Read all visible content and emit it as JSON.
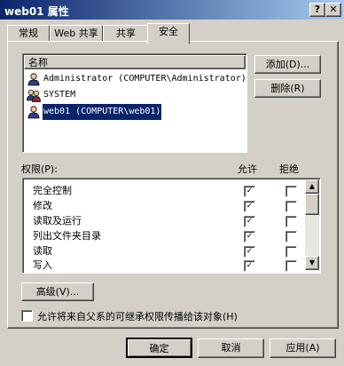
{
  "window": {
    "title": "web01 属性",
    "help_btn": "?",
    "close_btn": "✕"
  },
  "tabs": [
    {
      "label": "常规"
    },
    {
      "label": "Web 共享"
    },
    {
      "label": "共享"
    },
    {
      "label": "安全"
    }
  ],
  "users": {
    "header": "名称",
    "items": [
      {
        "name": "Administrator (COMPUTER\\Administrator)",
        "icon": "user-icon"
      },
      {
        "name": "SYSTEM",
        "icon": "group-icon"
      },
      {
        "name": "web01 (COMPUTER\\web01)",
        "icon": "user-icon",
        "selected": true
      }
    ],
    "add_button": "添加(D)...",
    "remove_button": "删除(R)"
  },
  "permissions": {
    "label": "权限(P):",
    "allow_header": "允许",
    "deny_header": "拒绝",
    "items": [
      {
        "name": "完全控制",
        "allow": true,
        "deny": false
      },
      {
        "name": "修改",
        "allow": true,
        "deny": false
      },
      {
        "name": "读取及运行",
        "allow": true,
        "deny": false
      },
      {
        "name": "列出文件夹目录",
        "allow": true,
        "deny": false
      },
      {
        "name": "读取",
        "allow": true,
        "deny": false
      },
      {
        "name": "写入",
        "allow": true,
        "deny": false
      }
    ]
  },
  "advanced_button": "高级(V)...",
  "inherit_label": "允许将来自父系的可继承权限传播给该对象(H)",
  "inherit_checked": false,
  "footer": {
    "ok": "确定",
    "cancel": "取消",
    "apply": "应用(A)"
  },
  "check_mark": "✓"
}
